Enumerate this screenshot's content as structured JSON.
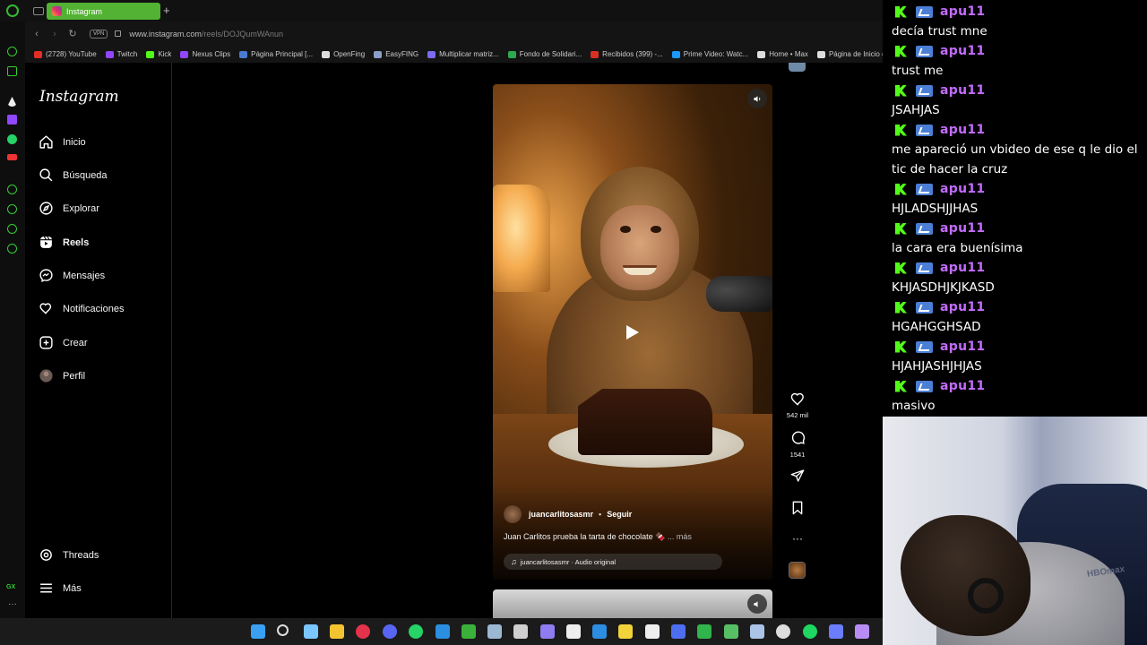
{
  "browser": {
    "tab_label": "Instagram",
    "vpn_label": "VPN",
    "url_host": "www.instagram.com",
    "url_path": "/reels/DOJQumWAnun"
  },
  "bookmarks": [
    {
      "label": "(2728) YouTube",
      "color": "#e52d27"
    },
    {
      "label": "Twitch",
      "color": "#9146ff"
    },
    {
      "label": "Kick",
      "color": "#53fc18"
    },
    {
      "label": "Nexus Clips",
      "color": "#9146ff"
    },
    {
      "label": "Página Principal [...",
      "color": "#4a7bd0"
    },
    {
      "label": "OpenFing",
      "color": "#dddddd"
    },
    {
      "label": "EasyFING",
      "color": "#8aa0c8"
    },
    {
      "label": "Multiplicar matriz...",
      "color": "#7b6cf0"
    },
    {
      "label": "Fondo de Solidari...",
      "color": "#2fa84f"
    },
    {
      "label": "Recibidos (399) -...",
      "color": "#d93025"
    },
    {
      "label": "Prime Video: Watc...",
      "color": "#1a98ff"
    },
    {
      "label": "Home • Max",
      "color": "#dddddd"
    },
    {
      "label": "Página de Inicio d...",
      "color": "#dddddd"
    }
  ],
  "instagram": {
    "logo": "Instagram",
    "nav": [
      {
        "label": "Inicio",
        "icon": "home-icon"
      },
      {
        "label": "Búsqueda",
        "icon": "search-icon"
      },
      {
        "label": "Explorar",
        "icon": "compass-icon"
      },
      {
        "label": "Reels",
        "icon": "reels-icon"
      },
      {
        "label": "Mensajes",
        "icon": "messenger-icon"
      },
      {
        "label": "Notificaciones",
        "icon": "heart-icon"
      },
      {
        "label": "Crear",
        "icon": "plus-square-icon"
      },
      {
        "label": "Perfil",
        "icon": "profile-avatar-icon"
      }
    ],
    "threads_label": "Threads",
    "more_label": "Más",
    "reel": {
      "username": "juancarlitosasmr",
      "follow_label": "Seguir",
      "caption": "Juan Carlitos prueba la tarta de chocolate 🍫",
      "caption_more": "... más",
      "audio": "juancarlitosasmr · Audio original",
      "likes": "542 mil",
      "comments": "1541"
    }
  },
  "chat": {
    "username": "apu11",
    "username_color": "#c36cff",
    "messages": [
      {
        "text": "decía trust mne"
      },
      {
        "text": "trust me"
      },
      {
        "text": "JSAHJAS"
      },
      {
        "text": "me apareció un vbideo de ese q le dio el tic de hacer la cruz"
      },
      {
        "text": "HJLADSHJJHAS"
      },
      {
        "text": "la cara era buenísima"
      },
      {
        "text": "KHJASDHJKJKASD"
      },
      {
        "text": "HGAHGGHSAD"
      },
      {
        "text": "HJAHJASHJHJAS"
      },
      {
        "text": "masivo"
      }
    ]
  },
  "webcam": {
    "hoodie_text": "HBOmax"
  }
}
